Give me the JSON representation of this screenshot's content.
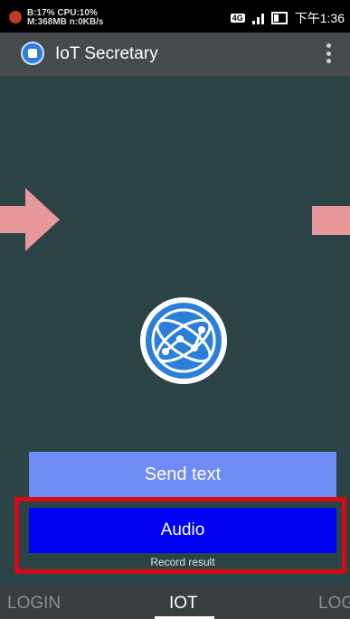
{
  "status_bar": {
    "line1": "B:17% CPU:10%",
    "line2": "M:368MB n:0KB/s",
    "network": "4G",
    "time": "下午1:36"
  },
  "app_bar": {
    "title": "IoT Secretary",
    "icon": "chip-icon",
    "menu_icon": "more-vert-icon"
  },
  "main": {
    "left_arrow_icon": "arrow-right-icon",
    "right_arrow_icon": "arrow-right-icon",
    "center_icon": "globe-network-icon",
    "send_text_label": "Send text",
    "audio_label": "Audio",
    "record_result": "Record result"
  },
  "tabs": [
    {
      "label": "LOGIN"
    },
    {
      "label": "IOT"
    },
    {
      "label": "LOG"
    }
  ],
  "colors": {
    "background": "#2c4346",
    "app_bar": "#464a4d",
    "send_button": "#6f8bf6",
    "audio_button": "#0000f5",
    "highlight": "#d40b17",
    "arrow": "#e8979b",
    "globe": "#2b7fd8"
  }
}
